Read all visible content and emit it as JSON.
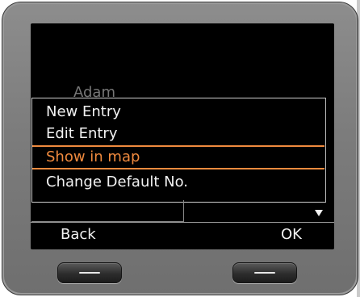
{
  "background_contact": {
    "name": "Adam"
  },
  "menu": {
    "items": [
      {
        "label": "New Entry",
        "selected": false
      },
      {
        "label": "Edit Entry",
        "selected": false
      },
      {
        "label": "Show in map",
        "selected": true
      },
      {
        "label": "Change Default No.",
        "selected": false
      }
    ],
    "scroll_indicator": "more-below-arrow-icon"
  },
  "softkeys": {
    "left_label": "Back",
    "right_label": "OK",
    "left_key_icon": "dash-icon",
    "right_key_icon": "dash-icon"
  },
  "colors": {
    "highlight": "#f08a3e",
    "text": "#f2f2f2",
    "screen_bg": "#000000",
    "bezel": "#7f7f7f"
  }
}
